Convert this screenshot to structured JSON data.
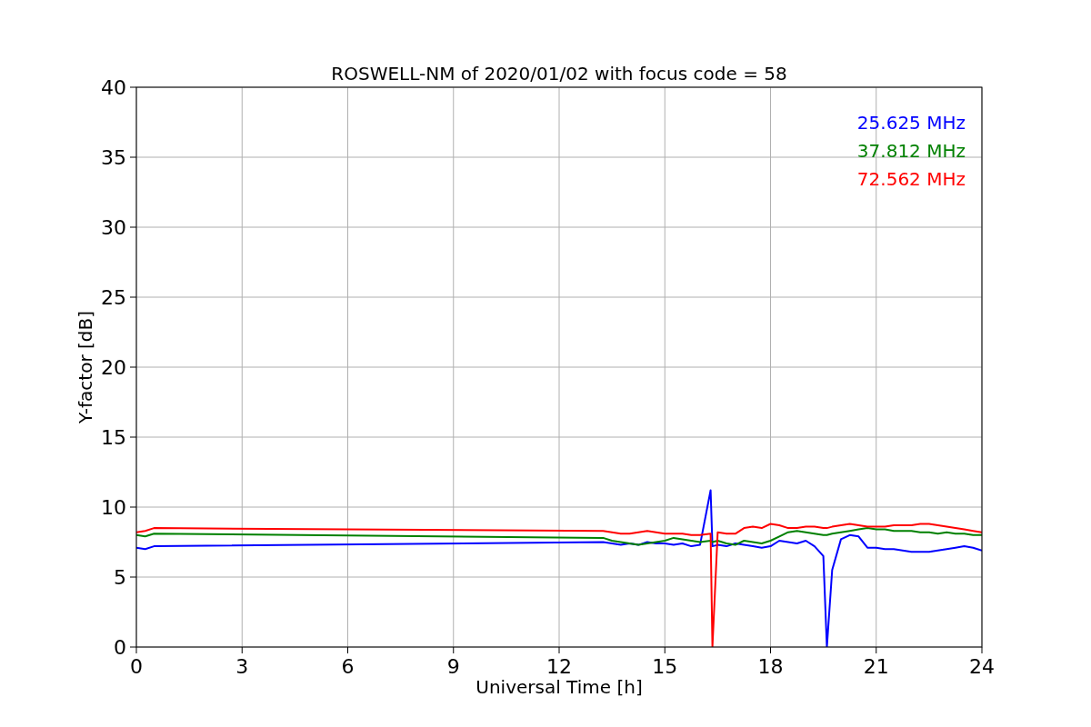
{
  "figure": {
    "chart_data": {
      "type": "line",
      "title": "ROSWELL-NM of 2020/01/02 with focus code = 58",
      "xlabel": "Universal Time [h]",
      "ylabel": "Y-factor [dB]",
      "xlim": [
        0,
        24
      ],
      "ylim": [
        0,
        40
      ],
      "grid": true,
      "xticks": [
        0,
        3,
        6,
        9,
        12,
        15,
        18,
        21,
        24
      ],
      "yticks": [
        0,
        5,
        10,
        15,
        20,
        25,
        30,
        35,
        40
      ],
      "x": [
        0,
        0.25,
        0.5,
        13.25,
        13.5,
        13.75,
        14,
        14.25,
        14.5,
        14.75,
        15,
        15.25,
        15.5,
        15.75,
        16,
        16.3,
        16.35,
        16.5,
        16.75,
        17,
        17.25,
        17.5,
        17.75,
        18,
        18.25,
        18.5,
        18.75,
        19,
        19.25,
        19.5,
        19.6,
        19.75,
        20,
        20.25,
        20.5,
        20.75,
        21,
        21.25,
        21.5,
        21.75,
        22,
        22.25,
        22.5,
        22.75,
        23,
        23.25,
        23.5,
        23.75,
        24
      ],
      "series": [
        {
          "name": "25.625 MHz",
          "color": "#0000ff",
          "values": [
            7.1,
            7.0,
            7.2,
            7.5,
            7.4,
            7.3,
            7.4,
            7.3,
            7.5,
            7.4,
            7.4,
            7.3,
            7.4,
            7.2,
            7.3,
            11.2,
            7.2,
            7.3,
            7.2,
            7.4,
            7.3,
            7.2,
            7.1,
            7.2,
            7.6,
            7.5,
            7.4,
            7.6,
            7.2,
            6.5,
            0.0,
            5.5,
            7.7,
            8.0,
            7.9,
            7.1,
            7.1,
            7.0,
            7.0,
            6.9,
            6.8,
            6.8,
            6.8,
            6.9,
            7.0,
            7.1,
            7.2,
            7.1,
            6.9
          ]
        },
        {
          "name": "37.812 MHz",
          "color": "#008000",
          "values": [
            8.0,
            7.9,
            8.1,
            7.8,
            7.6,
            7.5,
            7.4,
            7.3,
            7.4,
            7.5,
            7.6,
            7.8,
            7.7,
            7.6,
            7.5,
            7.6,
            7.5,
            7.6,
            7.4,
            7.3,
            7.6,
            7.5,
            7.4,
            7.6,
            7.9,
            8.2,
            8.3,
            8.2,
            8.1,
            8.0,
            8.0,
            8.1,
            8.2,
            8.3,
            8.4,
            8.5,
            8.4,
            8.4,
            8.3,
            8.3,
            8.3,
            8.2,
            8.2,
            8.1,
            8.2,
            8.1,
            8.1,
            8.0,
            8.0
          ]
        },
        {
          "name": "72.562 MHz",
          "color": "#ff0000",
          "values": [
            8.2,
            8.3,
            8.5,
            8.3,
            8.2,
            8.1,
            8.1,
            8.2,
            8.3,
            8.2,
            8.1,
            8.1,
            8.1,
            8.0,
            8.0,
            8.1,
            0.0,
            8.2,
            8.1,
            8.1,
            8.5,
            8.6,
            8.5,
            8.8,
            8.7,
            8.5,
            8.5,
            8.6,
            8.6,
            8.5,
            8.5,
            8.6,
            8.7,
            8.8,
            8.7,
            8.6,
            8.6,
            8.6,
            8.7,
            8.7,
            8.7,
            8.8,
            8.8,
            8.7,
            8.6,
            8.5,
            8.4,
            8.3,
            8.2
          ]
        }
      ]
    }
  }
}
